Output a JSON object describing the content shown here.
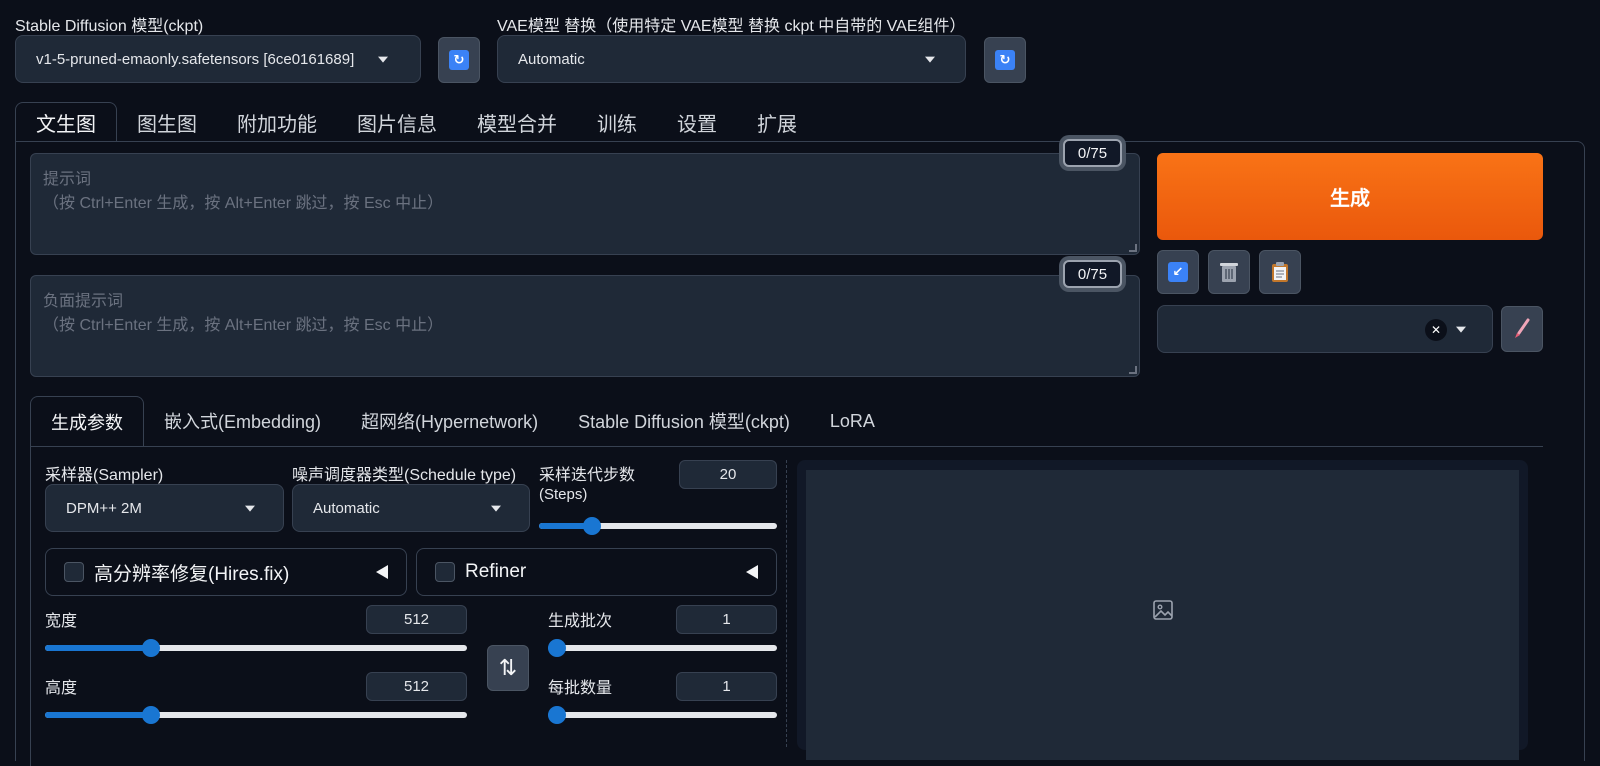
{
  "header": {
    "sd_model_label": "Stable Diffusion 模型(ckpt)",
    "sd_model_value": "v1-5-pruned-emaonly.safetensors [6ce0161689]",
    "vae_label": "VAE模型 替换（使用特定 VAE模型 替换 ckpt 中自带的 VAE组件）",
    "vae_value": "Automatic"
  },
  "main_tabs": [
    "文生图",
    "图生图",
    "附加功能",
    "图片信息",
    "模型合并",
    "训练",
    "设置",
    "扩展"
  ],
  "prompt": {
    "placeholder_title": "提示词",
    "placeholder_hint": "（按 Ctrl+Enter 生成，按 Alt+Enter 跳过，按 Esc 中止）",
    "counter": "0/75"
  },
  "negative_prompt": {
    "placeholder_title": "负面提示词",
    "placeholder_hint": "（按 Ctrl+Enter 生成，按 Alt+Enter 跳过，按 Esc 中止）",
    "counter": "0/75"
  },
  "generate_label": "生成",
  "toolbar_icons": [
    "arrow-icon",
    "trash-icon",
    "clipboard-icon"
  ],
  "styles": {
    "value": "",
    "clear_glyph": "✕"
  },
  "sub_tabs": [
    "生成参数",
    "嵌入式(Embedding)",
    "超网络(Hypernetwork)",
    "Stable Diffusion 模型(ckpt)",
    "LoRA"
  ],
  "params": {
    "sampler_label": "采样器(Sampler)",
    "sampler_value": "DPM++ 2M",
    "schedule_label": "噪声调度器类型(Schedule type)",
    "schedule_value": "Automatic",
    "steps_label_1": "采样迭代步数",
    "steps_label_2": "(Steps)",
    "steps_value": "20",
    "steps_fraction": 0.2,
    "hires_label": "高分辨率修复(Hires.fix)",
    "refiner_label": "Refiner",
    "width_label": "宽度",
    "width_value": "512",
    "width_fraction": 0.24,
    "height_label": "高度",
    "height_value": "512",
    "height_fraction": 0.24,
    "batch_count_label": "生成批次",
    "batch_count_value": "1",
    "batch_count_fraction": 0,
    "batch_size_label": "每批数量",
    "batch_size_value": "1",
    "batch_size_fraction": 0
  },
  "swap_glyph": "⇅",
  "colors": {
    "accent": "#1976d2",
    "generate": "#f97316",
    "background": "#0b0f19"
  }
}
